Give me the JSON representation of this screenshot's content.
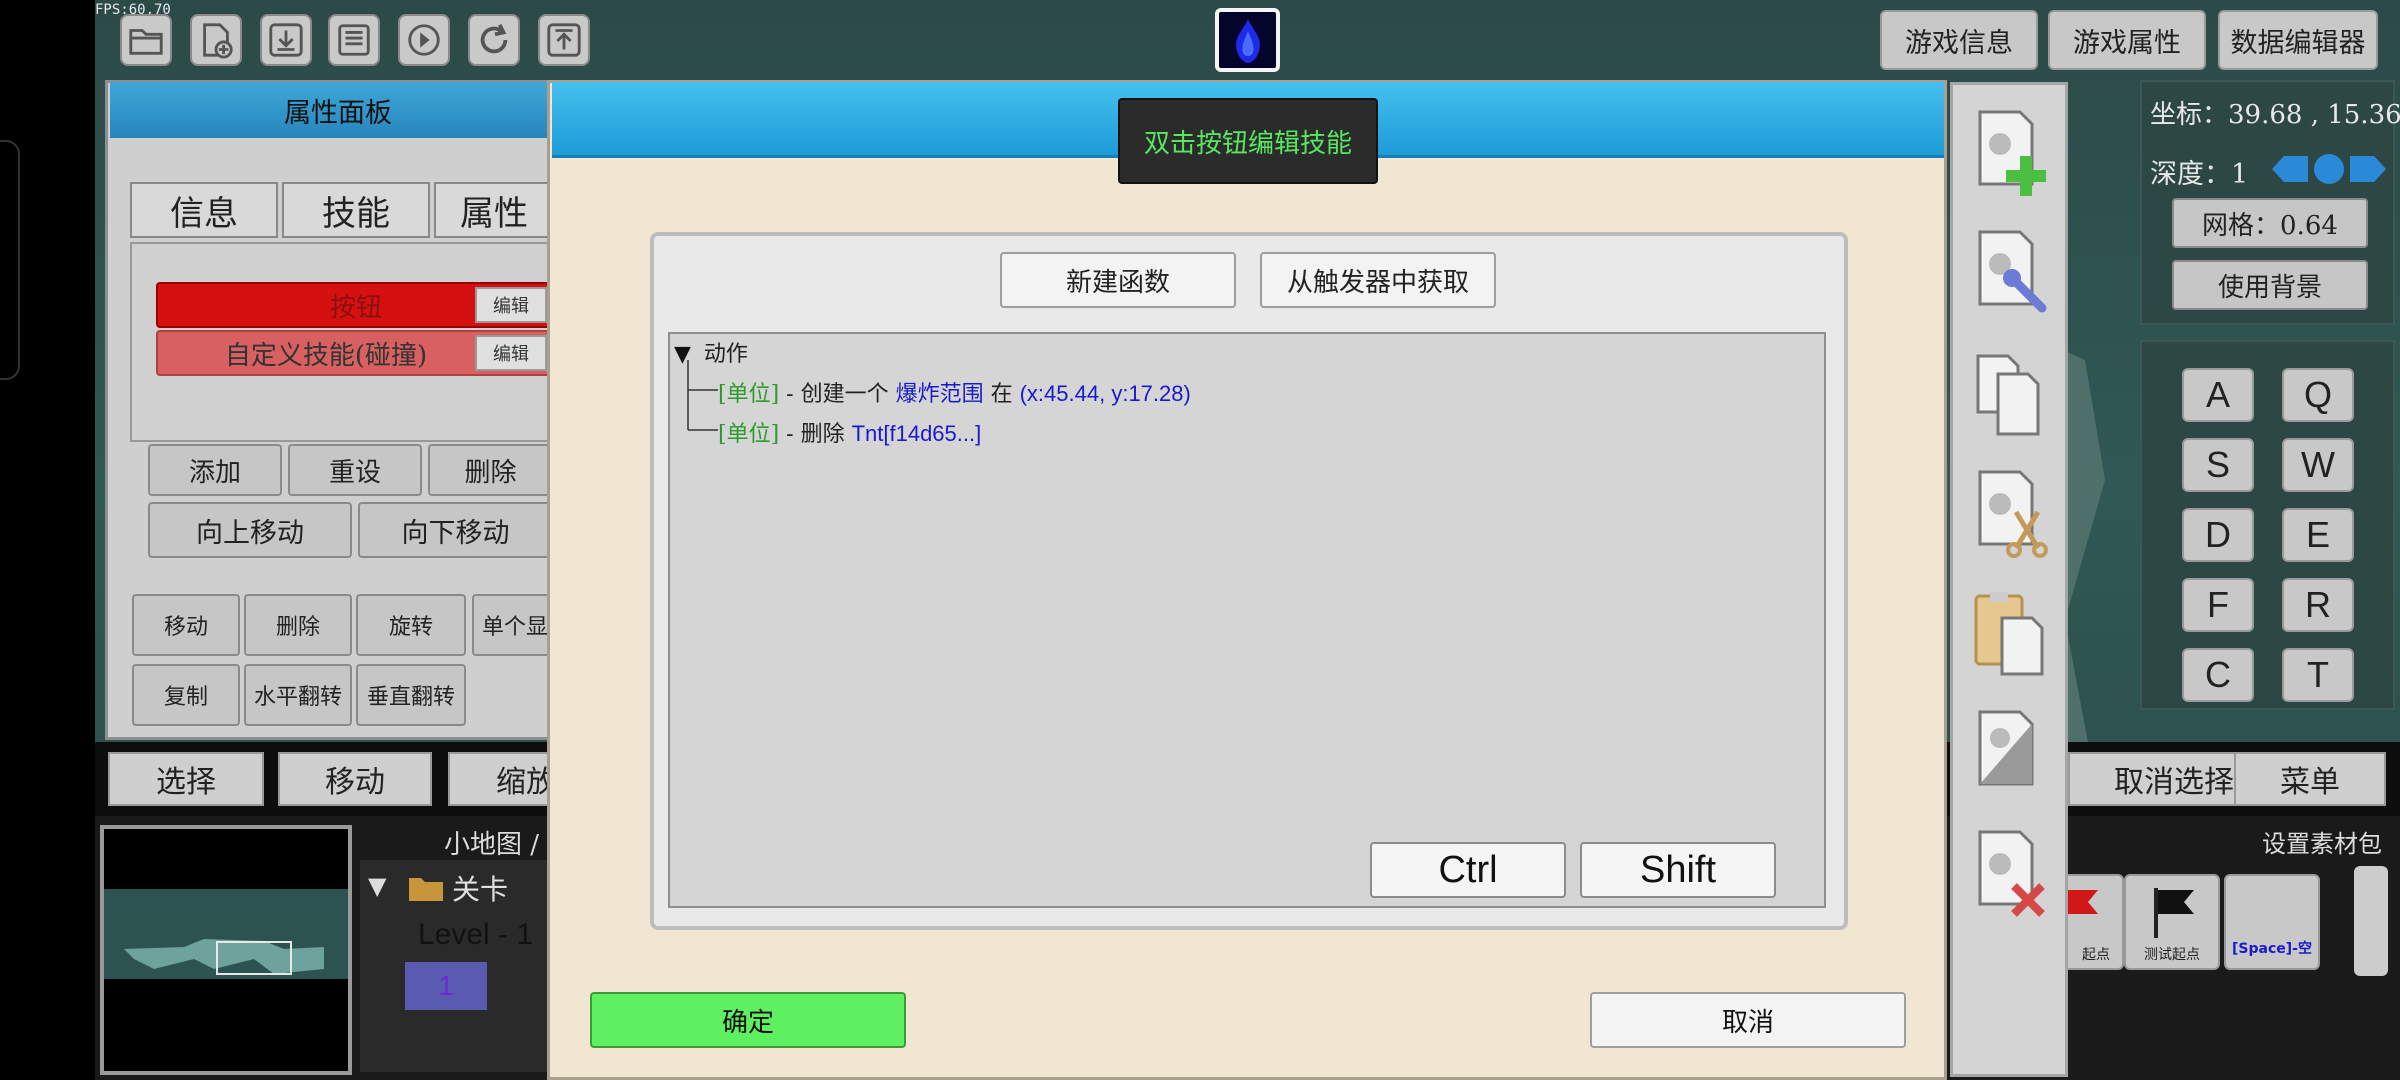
{
  "fps": "FPS:60.70",
  "top_tabs": {
    "game_info": "游戏信息",
    "game_props": "游戏属性",
    "data_editor": "数据编辑器"
  },
  "prop_panel": {
    "title": "属性面板",
    "tabs": [
      "信息",
      "技能",
      "属性"
    ],
    "skills": [
      {
        "name": "按钮",
        "edit": "编辑"
      },
      {
        "name": "自定义技能(碰撞)",
        "edit": "编辑"
      }
    ],
    "row1": [
      "添加",
      "重设",
      "删除"
    ],
    "row2": [
      "向上移动",
      "向下移动"
    ],
    "ops1": [
      "移动",
      "删除",
      "旋转",
      "单个显"
    ],
    "ops2": [
      "复制",
      "水平翻转",
      "垂直翻转"
    ]
  },
  "bottom_bar": {
    "select": "选择",
    "move": "移动",
    "scale": "缩放",
    "deselect": "取消选择",
    "menu": "菜单"
  },
  "minimap": {
    "label": "小地图 /",
    "folder": "关卡",
    "level": "Level - 1",
    "level_num": "1"
  },
  "right_panel": {
    "coords": "坐标：39.68 , 15.36",
    "depth": "深度：1",
    "grid": "网格：0.64",
    "use_bg": "使用背景",
    "keys": [
      "A",
      "Q",
      "S",
      "W",
      "D",
      "E",
      "F",
      "R",
      "C",
      "T"
    ]
  },
  "assets": {
    "set_material": "设置素材包",
    "items": [
      "起点",
      "测试起点",
      "[Space]-空"
    ]
  },
  "dialog": {
    "tooltip": "双击按钮编辑技能",
    "new_function": "新建函数",
    "from_trigger": "从触发器中获取",
    "tree_root": "动作",
    "actions": [
      {
        "tag": "[单位]",
        "text": " - 创建一个 ",
        "hl": "爆炸范围",
        "text2": " 在 ",
        "hl2": "(x:45.44, y:17.28)"
      },
      {
        "tag": "[单位]",
        "text": " - 删除 ",
        "hl": "Tnt[f14d65...]",
        "text2": "",
        "hl2": ""
      }
    ],
    "ctrl": "Ctrl",
    "shift": "Shift",
    "ok": "确定",
    "cancel": "取消"
  },
  "colors": {
    "accent_blue": "#29a6e0",
    "ok_green": "#5ef060",
    "tooltip_text": "#57e860",
    "tag_green": "#2d9a2d",
    "hl_blue": "#1a1acc"
  }
}
